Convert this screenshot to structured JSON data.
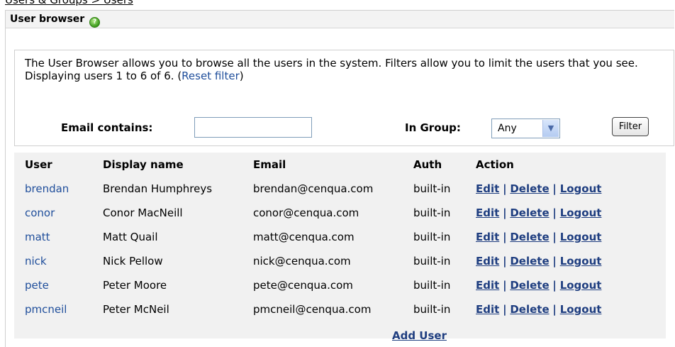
{
  "breadcrumb": "Users & Groups  >  Users",
  "panel": {
    "title": "User browser",
    "help_symbol": "?"
  },
  "info": {
    "description": "The User Browser allows you to browse all the users in the system. Filters allow you to limit the users that you see.",
    "displaying": "Displaying users 1 to 6 of 6.",
    "reset_filter": "Reset filter"
  },
  "filter": {
    "email_label": "Email contains:",
    "email_value": "",
    "group_label": "In Group:",
    "group_value": "Any",
    "button_label": "Filter"
  },
  "table": {
    "headers": [
      "User",
      "Display name",
      "Email",
      "Auth",
      "Action"
    ],
    "rows": [
      {
        "user": "brendan",
        "display_name": "Brendan Humphreys",
        "email": "brendan@cenqua.com",
        "auth": "built-in"
      },
      {
        "user": "conor",
        "display_name": "Conor MacNeill",
        "email": "conor@cenqua.com",
        "auth": "built-in"
      },
      {
        "user": "matt",
        "display_name": "Matt Quail",
        "email": "matt@cenqua.com",
        "auth": "built-in"
      },
      {
        "user": "nick",
        "display_name": "Nick Pellow",
        "email": "nick@cenqua.com",
        "auth": "built-in"
      },
      {
        "user": "pete",
        "display_name": "Peter Moore",
        "email": "pete@cenqua.com",
        "auth": "built-in"
      },
      {
        "user": "pmcneil",
        "display_name": "Peter McNeil",
        "email": "pmcneil@cenqua.com",
        "auth": "built-in"
      }
    ],
    "actions": {
      "edit": "Edit",
      "delete": "Delete",
      "logout": "Logout",
      "separator": "|"
    },
    "add_user": "Add User"
  },
  "colors": {
    "link": "#1f4e9b",
    "action_link": "#1f3e80",
    "table_bg": "#f1f1f1"
  }
}
